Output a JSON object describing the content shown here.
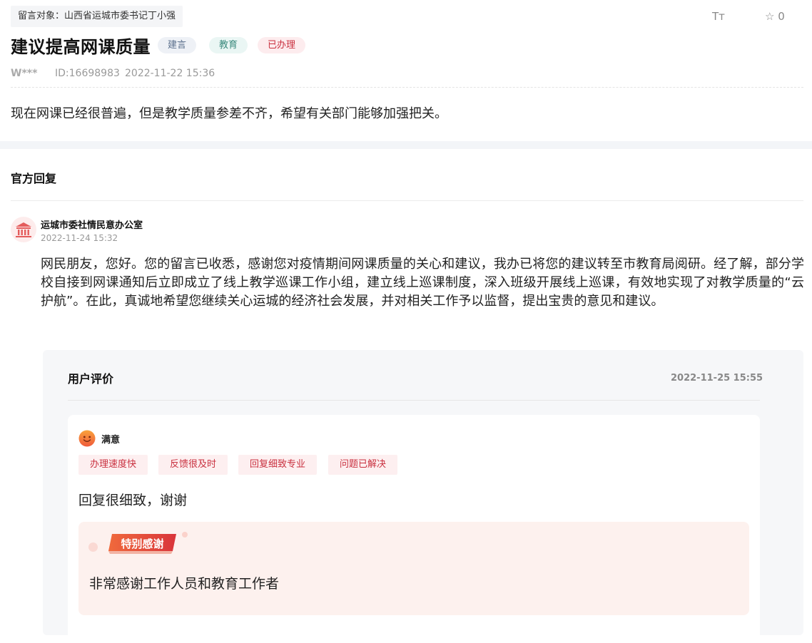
{
  "header": {
    "target_label": "留言对象：山西省运城市委书记丁小强",
    "font_icon_label": "Tт",
    "star_icon": "☆",
    "star_count": "0"
  },
  "message": {
    "title": "建议提高网课质量",
    "tags": [
      "建言",
      "教育",
      "已办理"
    ],
    "author": "W***",
    "id": "ID:16698983",
    "time": "2022-11-22 15:36",
    "content": "现在网课已经很普遍，但是教学质量参差不齐，希望有关部门能够加强把关。"
  },
  "reply": {
    "section_title": "官方回复",
    "org_icon": "🏛",
    "org": "运城市委社情民意办公室",
    "time": "2022-11-24 15:32",
    "text": "网民朋友，您好。您的留言已收悉，感谢您对疫情期间网课质量的关心和建议，我办已将您的建议转至市教育局阅研。经了解，部分学校自接到网课通知后立即成立了线上教学巡课工作小组，建立线上巡课制度，深入班级开展线上巡课，有效地实现了对教学质量的“云护航”。在此，真诚地希望您继续关心运城的经济社会发展，并对相关工作予以监督，提出宝贵的意见和建议。"
  },
  "evaluation": {
    "title": "用户评价",
    "time": "2022-11-25 15:55",
    "rating": "满意",
    "tags": [
      "办理速度快",
      "反馈很及时",
      "回复细致专业",
      "问题已解决"
    ],
    "comment": "回复很细致，谢谢",
    "thanks_badge": "特别感谢",
    "thanks_text": "非常感谢工作人员和教育工作者"
  },
  "colors": {
    "accent_red": "#c9303f",
    "tag_bg_red": "#fdeff0",
    "badge_red": "#e0453a"
  }
}
